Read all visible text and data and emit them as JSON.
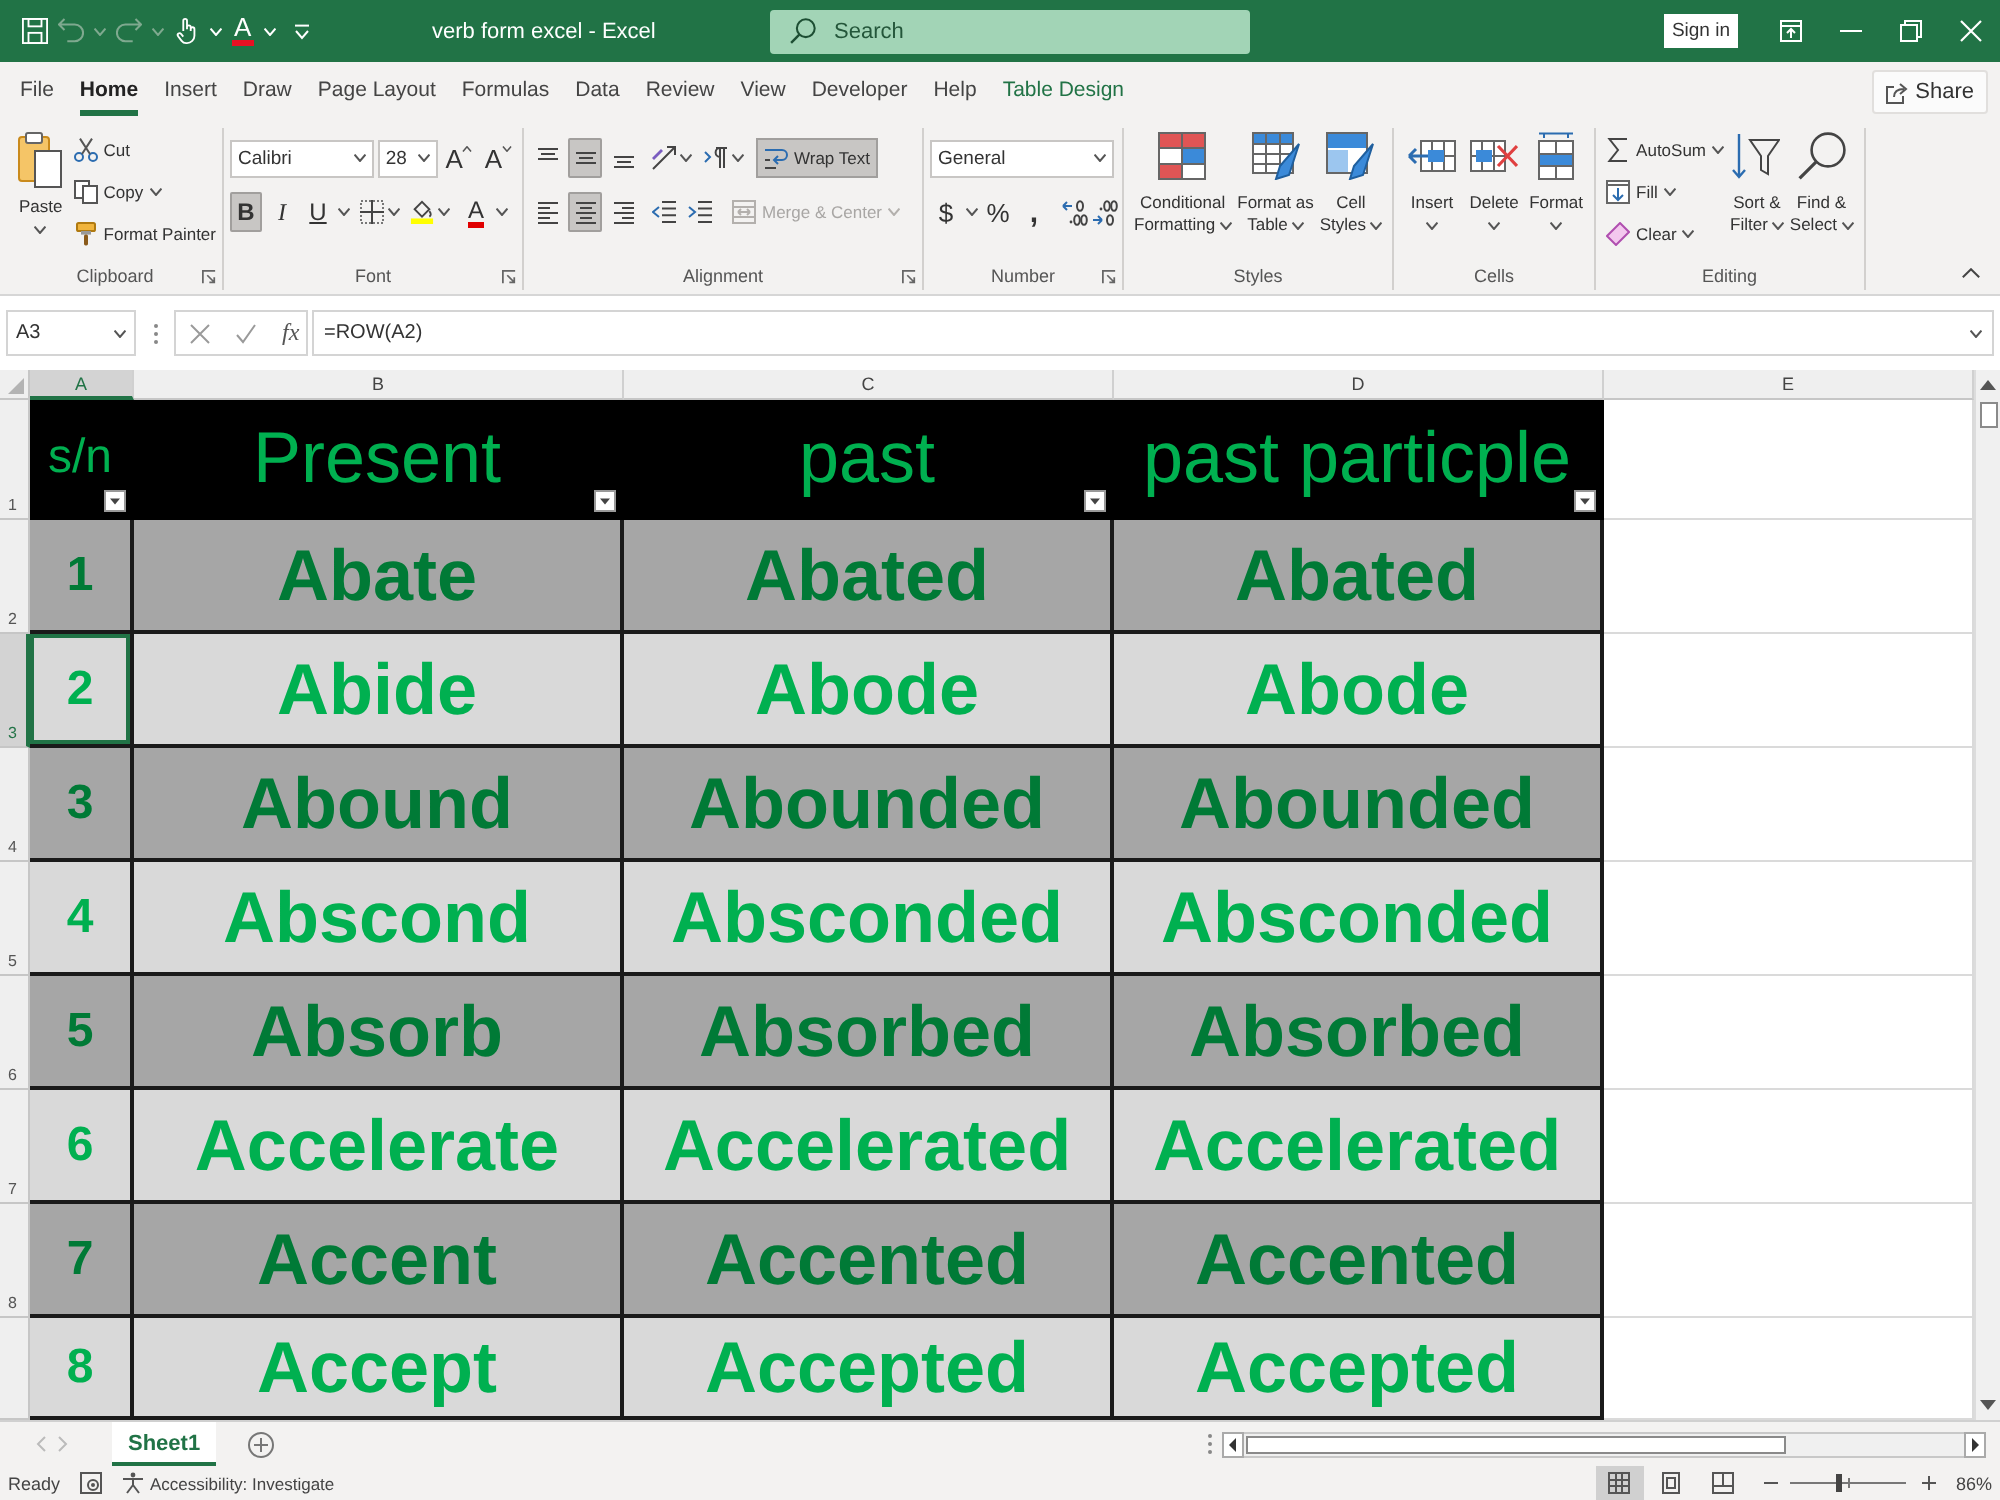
{
  "title_bar": {
    "quick_access": {
      "undo": {
        "disabled": true
      },
      "redo": {
        "disabled": true
      },
      "font_color": "A"
    },
    "title": "verb form excel - Excel",
    "search": {
      "placeholder": "Search"
    },
    "sign_in": "Sign in"
  },
  "menu_tabs": [
    {
      "label": "File",
      "selected": false,
      "contextual": false
    },
    {
      "label": "Home",
      "selected": true,
      "contextual": false
    },
    {
      "label": "Insert",
      "selected": false,
      "contextual": false
    },
    {
      "label": "Draw",
      "selected": false,
      "contextual": false
    },
    {
      "label": "Page Layout",
      "selected": false,
      "contextual": false
    },
    {
      "label": "Formulas",
      "selected": false,
      "contextual": false
    },
    {
      "label": "Data",
      "selected": false,
      "contextual": false
    },
    {
      "label": "Review",
      "selected": false,
      "contextual": false
    },
    {
      "label": "View",
      "selected": false,
      "contextual": false
    },
    {
      "label": "Developer",
      "selected": false,
      "contextual": false
    },
    {
      "label": "Help",
      "selected": false,
      "contextual": false
    },
    {
      "label": "Table Design",
      "selected": false,
      "contextual": true
    }
  ],
  "share_button": "Share",
  "ribbon": {
    "clipboard": {
      "label": "Clipboard",
      "paste": "Paste",
      "cut": "Cut",
      "copy": "Copy",
      "format_painter": "Format Painter"
    },
    "font": {
      "label": "Font",
      "font_name": "Calibri",
      "font_size": "28",
      "grow": "A",
      "shrink": "A",
      "styles": [
        {
          "label": "B",
          "selected": true
        },
        {
          "label": "I",
          "selected": false
        },
        {
          "label": "U",
          "selected": false
        }
      ],
      "font_color": "A"
    },
    "alignment": {
      "label": "Alignment",
      "vertical": [
        {
          "selected": false
        },
        {
          "selected": true
        },
        {
          "selected": false
        }
      ],
      "horizontal": [
        {
          "selected": false
        },
        {
          "selected": true
        },
        {
          "selected": false
        }
      ],
      "wrap_text": {
        "label": "Wrap Text",
        "selected": true
      },
      "merge_center": {
        "label": "Merge & Center",
        "disabled": true
      }
    },
    "number": {
      "label": "Number",
      "format": "General",
      "currency": "$",
      "percent": "%",
      "comma": ","
    },
    "styles": {
      "label": "Styles",
      "buttons": [
        {
          "label": [
            "Conditional",
            "Formatting"
          ]
        },
        {
          "label": [
            "Format as",
            "Table"
          ]
        },
        {
          "label": [
            "Cell",
            "Styles"
          ]
        }
      ]
    },
    "cells": {
      "label": "Cells",
      "buttons": [
        "Insert",
        "Delete",
        "Format"
      ]
    },
    "editing": {
      "label": "Editing",
      "autosum": "AutoSum",
      "fill": "Fill",
      "clear": "Clear",
      "sort_filter": [
        "Sort &",
        "Filter"
      ],
      "find_select": [
        "Find &",
        "Select"
      ]
    }
  },
  "formula_bar": {
    "name_box": "A3",
    "function_label": "fx",
    "formula": "=ROW(A2)"
  },
  "sheet": {
    "columns": [
      "A",
      "B",
      "C",
      "D",
      "E"
    ],
    "rows": [
      {
        "label": "1",
        "kind": "header",
        "cells": [
          {
            "text": "s/n",
            "selected": false
          },
          {
            "text": "Present",
            "selected": false
          },
          {
            "text": "past",
            "selected": false
          },
          {
            "text": "past particple",
            "selected": false
          }
        ]
      },
      {
        "label": "2",
        "kind": "dark",
        "cells": [
          {
            "text": "1",
            "selected": false
          },
          {
            "text": "Abate",
            "selected": false
          },
          {
            "text": "Abated",
            "selected": false
          },
          {
            "text": "Abated",
            "selected": false
          }
        ]
      },
      {
        "label": "3",
        "kind": "light",
        "cells": [
          {
            "text": "2",
            "selected": true
          },
          {
            "text": "Abide",
            "selected": false
          },
          {
            "text": "Abode",
            "selected": false
          },
          {
            "text": "Abode",
            "selected": false
          }
        ]
      },
      {
        "label": "4",
        "kind": "dark",
        "cells": [
          {
            "text": "3",
            "selected": false
          },
          {
            "text": "Abound",
            "selected": false
          },
          {
            "text": "Abounded",
            "selected": false
          },
          {
            "text": "Abounded",
            "selected": false
          }
        ]
      },
      {
        "label": "5",
        "kind": "light",
        "cells": [
          {
            "text": "4",
            "selected": false
          },
          {
            "text": "Abscond",
            "selected": false
          },
          {
            "text": "Absconded",
            "selected": false
          },
          {
            "text": "Absconded",
            "selected": false
          }
        ]
      },
      {
        "label": "6",
        "kind": "dark",
        "cells": [
          {
            "text": "5",
            "selected": false
          },
          {
            "text": "Absorb",
            "selected": false
          },
          {
            "text": "Absorbed",
            "selected": false
          },
          {
            "text": "Absorbed",
            "selected": false
          }
        ]
      },
      {
        "label": "7",
        "kind": "light",
        "cells": [
          {
            "text": "6",
            "selected": false
          },
          {
            "text": "Accelerate",
            "selected": false
          },
          {
            "text": "Accelerated",
            "selected": false
          },
          {
            "text": "Accelerated",
            "selected": false
          }
        ]
      },
      {
        "label": "8",
        "kind": "dark",
        "cells": [
          {
            "text": "7",
            "selected": false
          },
          {
            "text": "Accent",
            "selected": false
          },
          {
            "text": "Accented",
            "selected": false
          },
          {
            "text": "Accented",
            "selected": false
          }
        ]
      },
      {
        "kind": "light",
        "cells": [
          {
            "text": "8",
            "selected": false
          },
          {
            "text": "Accept",
            "selected": false
          },
          {
            "text": "Accepted",
            "selected": false
          },
          {
            "text": "Accepted",
            "selected": false
          }
        ]
      }
    ]
  },
  "sheet_tabs": [
    {
      "label": "Sheet1",
      "selected": true
    }
  ],
  "status_bar": {
    "mode": "Ready",
    "accessibility": "Accessibility: Investigate",
    "views": [
      {
        "selected": true
      },
      {
        "selected": false
      },
      {
        "selected": false
      }
    ],
    "zoom": {
      "level": 0.42,
      "reading": "86%"
    }
  }
}
